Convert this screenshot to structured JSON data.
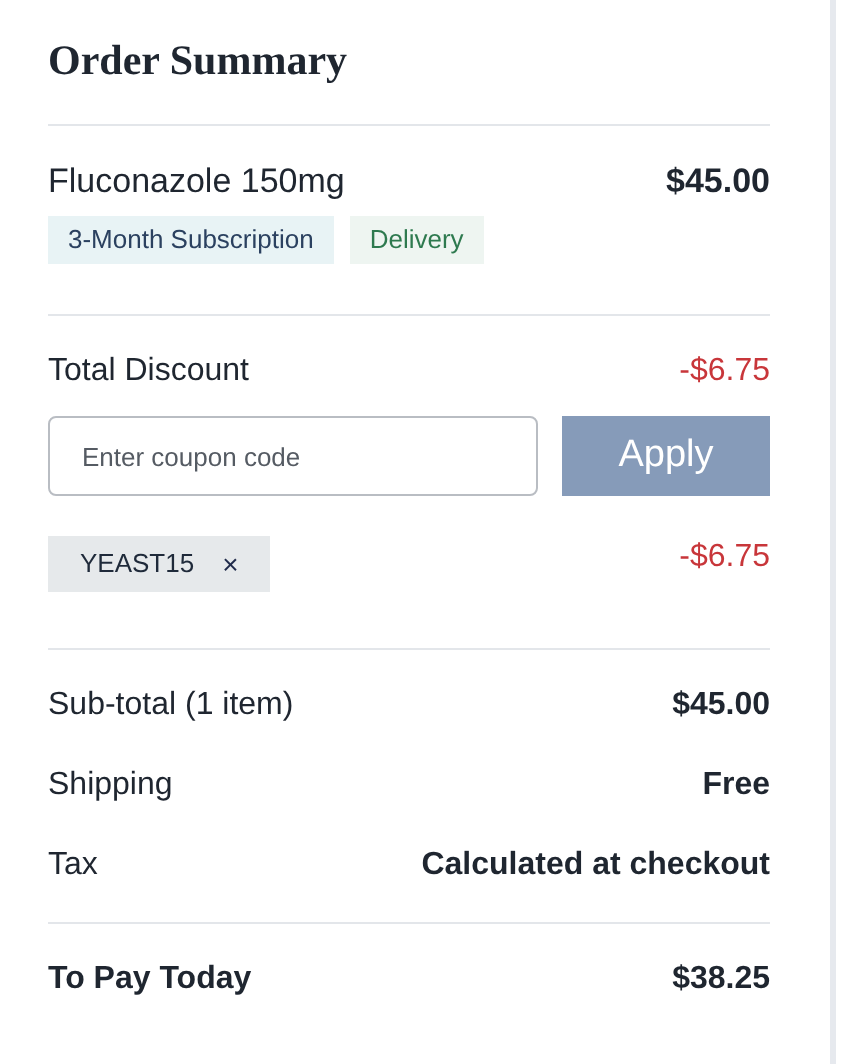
{
  "title": "Order Summary",
  "item": {
    "name": "Fluconazole 150mg",
    "price": "$45.00",
    "tags": [
      {
        "label": "3-Month Subscription",
        "kind": "subscription"
      },
      {
        "label": "Delivery",
        "kind": "delivery"
      }
    ]
  },
  "discount": {
    "label": "Total Discount",
    "amount": "-$6.75"
  },
  "coupon": {
    "placeholder": "Enter coupon code",
    "button": "Apply",
    "disabled": true
  },
  "applied_coupon": {
    "code": "YEAST15",
    "remove": "×",
    "amount": "-$6.75"
  },
  "totals": [
    {
      "label": "Sub-total (1 item)",
      "value": "$45.00"
    },
    {
      "label": "Shipping",
      "value": "Free"
    },
    {
      "label": "Tax",
      "value": "Calculated at checkout"
    }
  ],
  "to_pay": {
    "label": "To Pay Today",
    "value": "$38.25"
  }
}
